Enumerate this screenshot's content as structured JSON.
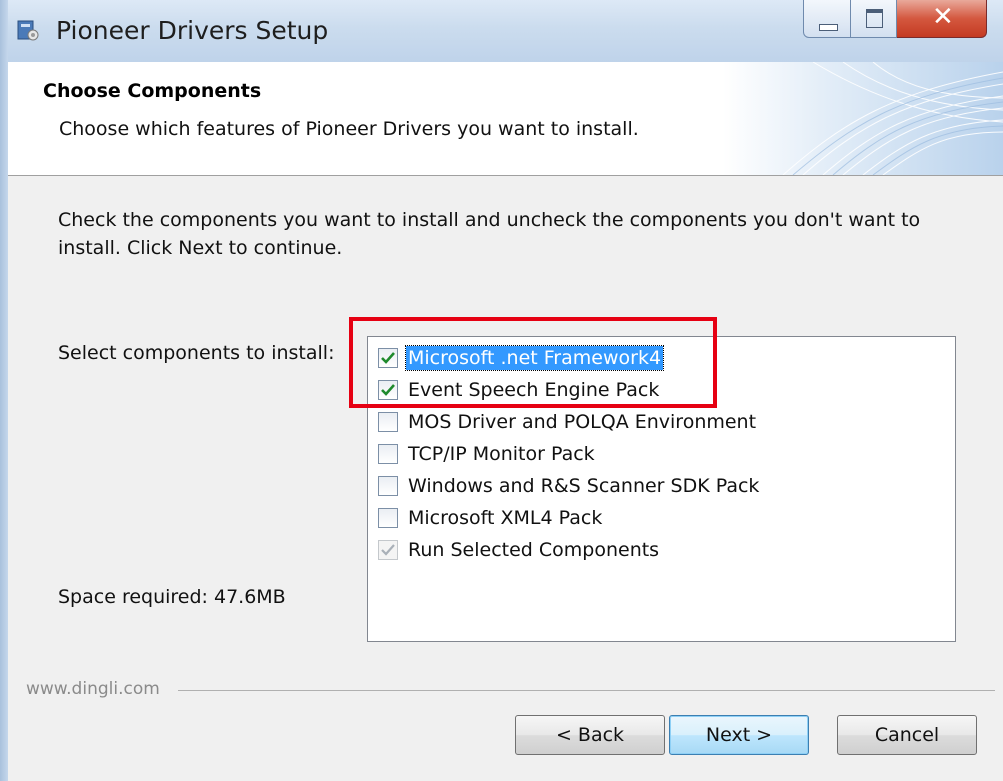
{
  "window": {
    "title": "Pioneer Drivers Setup"
  },
  "header": {
    "title": "Choose Components",
    "subtitle": "Choose which features of Pioneer Drivers you want to install."
  },
  "content": {
    "description": "Check the components you want to install and uncheck the components you don't want to install. Click Next to continue.",
    "select_label": "Select components to install:",
    "space_required": "Space required: 47.6MB"
  },
  "components": [
    {
      "label": "Microsoft .net Framework4",
      "checked": true,
      "selected": true,
      "disabled": false
    },
    {
      "label": "Event Speech Engine Pack",
      "checked": true,
      "selected": false,
      "disabled": false
    },
    {
      "label": "MOS Driver and POLQA Environment",
      "checked": false,
      "selected": false,
      "disabled": false
    },
    {
      "label": "TCP/IP Monitor Pack",
      "checked": false,
      "selected": false,
      "disabled": false
    },
    {
      "label": "Windows and R&S Scanner SDK Pack",
      "checked": false,
      "selected": false,
      "disabled": false
    },
    {
      "label": "Microsoft XML4 Pack",
      "checked": false,
      "selected": false,
      "disabled": false
    },
    {
      "label": "Run Selected Components",
      "checked": true,
      "selected": false,
      "disabled": true
    }
  ],
  "footer": {
    "brand": "www.dingli.com",
    "back_label": "< Back",
    "next_label": "Next >",
    "cancel_label": "Cancel"
  },
  "colors": {
    "highlight_box": "#e60012",
    "selection": "#3399ff",
    "checkmark": "#1f8a2d"
  }
}
